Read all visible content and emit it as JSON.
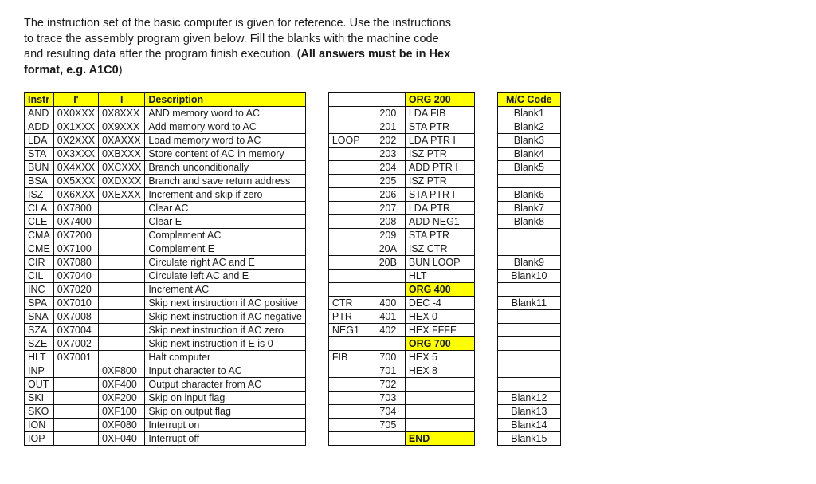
{
  "intro": {
    "line1": "The instruction set of the basic computer is given for reference. Use the instructions",
    "line2": "to trace the assembly program given below. Fill the blanks with the machine code",
    "line3": "and resulting data after the program finish execution. (",
    "bold1": "All answers must be in Hex",
    "line4": "format, e.g. A1C0",
    "line5": ")"
  },
  "instructions": {
    "headers": {
      "instr": "Instr",
      "iprime": "I'",
      "i": "I",
      "desc": "Description"
    },
    "rows": [
      {
        "instr": "AND",
        "iprime": "0X0XXX",
        "i": "0X8XXX",
        "desc": "AND memory word to AC"
      },
      {
        "instr": "ADD",
        "iprime": "0X1XXX",
        "i": "0X9XXX",
        "desc": "Add memory word to AC"
      },
      {
        "instr": "LDA",
        "iprime": "0X2XXX",
        "i": "0XAXXX",
        "desc": "Load memory word to AC"
      },
      {
        "instr": "STA",
        "iprime": "0X3XXX",
        "i": "0XBXXX",
        "desc": "Store content of AC in memory"
      },
      {
        "instr": "BUN",
        "iprime": "0X4XXX",
        "i": "0XCXXX",
        "desc": "Branch unconditionally"
      },
      {
        "instr": "BSA",
        "iprime": "0X5XXX",
        "i": "0XDXXX",
        "desc": "Branch and save return address"
      },
      {
        "instr": "ISZ",
        "iprime": "0X6XXX",
        "i": "0XEXXX",
        "desc": "Increment and skip if zero"
      },
      {
        "instr": "CLA",
        "iprime": "0X7800",
        "i": "",
        "desc": "Clear AC"
      },
      {
        "instr": "CLE",
        "iprime": "0X7400",
        "i": "",
        "desc": "Clear E"
      },
      {
        "instr": "CMA",
        "iprime": "0X7200",
        "i": "",
        "desc": "Complement AC"
      },
      {
        "instr": "CME",
        "iprime": "0X7100",
        "i": "",
        "desc": "Complement E"
      },
      {
        "instr": "CIR",
        "iprime": "0X7080",
        "i": "",
        "desc": "Circulate right AC and E"
      },
      {
        "instr": "CIL",
        "iprime": "0X7040",
        "i": "",
        "desc": "Circulate left AC and E"
      },
      {
        "instr": "INC",
        "iprime": "0X7020",
        "i": "",
        "desc": "Increment AC"
      },
      {
        "instr": "SPA",
        "iprime": "0X7010",
        "i": "",
        "desc": "Skip next instruction if AC positive"
      },
      {
        "instr": "SNA",
        "iprime": "0X7008",
        "i": "",
        "desc": "Skip next instruction if AC negative"
      },
      {
        "instr": "SZA",
        "iprime": "0X7004",
        "i": "",
        "desc": "Skip next instruction if AC zero"
      },
      {
        "instr": "SZE",
        "iprime": "0X7002",
        "i": "",
        "desc": "Skip next instruction if E is 0"
      },
      {
        "instr": "HLT",
        "iprime": "0X7001",
        "i": "",
        "desc": "Halt computer"
      },
      {
        "instr": "INP",
        "iprime": "",
        "i": "0XF800",
        "desc": "Input character to AC"
      },
      {
        "instr": "OUT",
        "iprime": "",
        "i": "0XF400",
        "desc": "Output character from AC"
      },
      {
        "instr": "SKI",
        "iprime": "",
        "i": "0XF200",
        "desc": "Skip on input flag"
      },
      {
        "instr": "SKO",
        "iprime": "",
        "i": "0XF100",
        "desc": "Skip on output flag"
      },
      {
        "instr": "ION",
        "iprime": "",
        "i": "0XF080",
        "desc": "Interrupt on"
      },
      {
        "instr": "IOP",
        "iprime": "",
        "i": "0XF040",
        "desc": "Interrupt off"
      }
    ]
  },
  "program": {
    "rows": [
      {
        "label": "",
        "addr": "",
        "asm": "ORG 200",
        "hi": true
      },
      {
        "label": "",
        "addr": "200",
        "asm": "LDA FIB"
      },
      {
        "label": "",
        "addr": "201",
        "asm": "STA PTR"
      },
      {
        "label": "LOOP",
        "addr": "202",
        "asm": "LDA PTR I"
      },
      {
        "label": "",
        "addr": "203",
        "asm": "ISZ PTR"
      },
      {
        "label": "",
        "addr": "204",
        "asm": "ADD PTR I"
      },
      {
        "label": "",
        "addr": "205",
        "asm": "ISZ PTR"
      },
      {
        "label": "",
        "addr": "206",
        "asm": "STA PTR I"
      },
      {
        "label": "",
        "addr": "207",
        "asm": "LDA PTR"
      },
      {
        "label": "",
        "addr": "208",
        "asm": "ADD NEG1"
      },
      {
        "label": "",
        "addr": "209",
        "asm": "STA PTR"
      },
      {
        "label": "",
        "addr": "20A",
        "asm": "ISZ CTR"
      },
      {
        "label": "",
        "addr": "20B",
        "asm": "BUN LOOP"
      },
      {
        "label": "",
        "addr": "",
        "asm": "HLT"
      },
      {
        "label": "",
        "addr": "",
        "asm": "ORG 400",
        "hi": true
      },
      {
        "label": "CTR",
        "addr": "400",
        "asm": "DEC -4"
      },
      {
        "label": "PTR",
        "addr": "401",
        "asm": "HEX 0"
      },
      {
        "label": "NEG1",
        "addr": "402",
        "asm": "HEX FFFF"
      },
      {
        "label": "",
        "addr": "",
        "asm": "ORG 700",
        "hi": true
      },
      {
        "label": "FIB",
        "addr": "700",
        "asm": "HEX 5"
      },
      {
        "label": "",
        "addr": "701",
        "asm": "HEX 8"
      },
      {
        "label": "",
        "addr": "702",
        "asm": ""
      },
      {
        "label": "",
        "addr": "703",
        "asm": ""
      },
      {
        "label": "",
        "addr": "704",
        "asm": ""
      },
      {
        "label": "",
        "addr": "705",
        "asm": ""
      },
      {
        "label": "",
        "addr": "",
        "asm": "END",
        "hi": true
      }
    ]
  },
  "mc": {
    "header": "M/C Code",
    "rows": [
      "Blank1",
      "Blank2",
      "Blank3",
      "Blank4",
      "Blank5",
      "",
      "Blank6",
      "Blank7",
      "Blank8",
      "",
      "",
      "Blank9",
      "Blank10",
      "",
      "Blank11",
      "",
      "",
      "",
      "",
      "",
      "",
      "Blank12",
      "Blank13",
      "Blank14",
      "Blank15"
    ]
  }
}
